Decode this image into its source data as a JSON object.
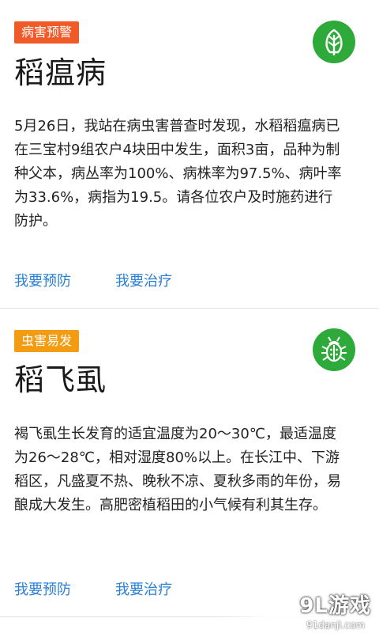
{
  "colors": {
    "badge_disease": "#f05a28",
    "badge_pest": "#f39c12",
    "icon_green": "#2eaa3a",
    "link_blue": "#2a7fd4"
  },
  "cards": [
    {
      "badge": "病害预警",
      "title": "稻瘟病",
      "icon": "leaf-icon",
      "body": "5月26日，我站在病虫害普查时发现，水稻稻瘟病已在三宝村9组农户4块田中发生，面积3亩，品种为制种父本，病丛率为100%、病株率为97.5%、病叶率为33.6%，病指为19.5。请各位农户及时施药进行防护。",
      "prevent_label": "我要预防",
      "treat_label": "我要治疗"
    },
    {
      "badge": "虫害易发",
      "title": "稻飞虱",
      "icon": "bug-icon",
      "body": "褐飞虱生长发育的适宜温度为20～30℃，最适温度为26～28℃，相对湿度80%以上。在长江中、下游稻区，凡盛夏不热、晚秋不凉、夏秋多雨的年份，易酿成大发生。高肥密植稻田的小气候有利其生存。",
      "prevent_label": "我要预防",
      "treat_label": "我要治疗"
    }
  ],
  "watermark": {
    "logo": "9L游戏",
    "url": "91danji.com"
  }
}
